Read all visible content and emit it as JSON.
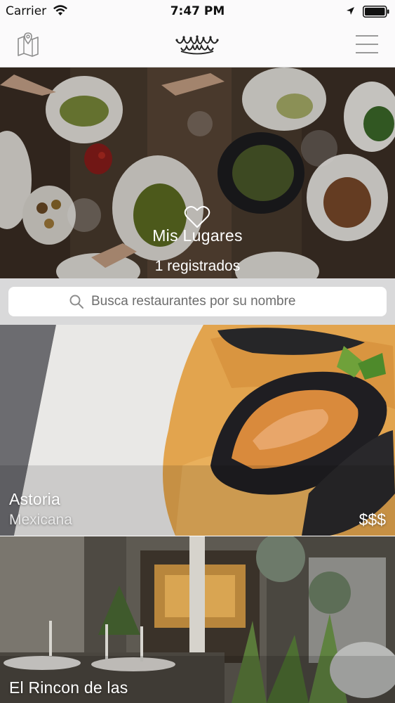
{
  "status_bar": {
    "carrier": "Carrier",
    "time": "7:47 PM"
  },
  "nav": {
    "map_icon": "map-icon",
    "logo_icon": "crown-logo-icon",
    "menu_icon": "hamburger-menu-icon"
  },
  "hero": {
    "icon": "heart-icon",
    "title": "Mis Lugares",
    "subtitle": "1 registrados"
  },
  "search": {
    "placeholder": "Busca restaurantes por su nombre"
  },
  "restaurants": [
    {
      "name": "Astoria",
      "cuisine": "Mexicana",
      "price": "$$$"
    },
    {
      "name": "El Rincon de las",
      "cuisine": "",
      "price": ""
    }
  ],
  "colors": {
    "search_area_bg": "#d9d9da",
    "nav_bg": "#fbfafb",
    "text_on_image": "#ffffff"
  }
}
